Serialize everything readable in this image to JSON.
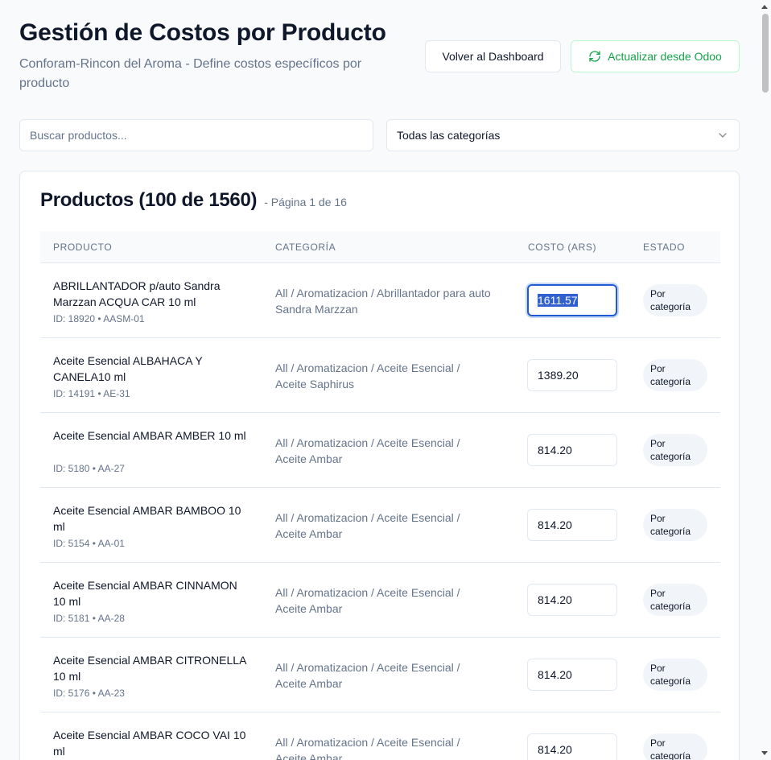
{
  "header": {
    "title": "Gestión de Costos por Producto",
    "subtitle": "Conforam-Rincon del Aroma - Define costos específicos por producto",
    "back_button": "Volver al Dashboard",
    "refresh_button": "Actualizar desde Odoo"
  },
  "filters": {
    "search_placeholder": "Buscar productos...",
    "category_selected": "Todas las categorías"
  },
  "products_card": {
    "title": "Productos (100 de 1560)",
    "page_info": "- Página 1 de 16",
    "columns": [
      "PRODUCTO",
      "CATEGORÍA",
      "COSTO (ARS)",
      "ESTADO"
    ],
    "rows": [
      {
        "name": "ABRILLANTADOR p/auto Sandra Marzzan ACQUA CAR 10 ml",
        "meta": "ID: 18920 • AASM-01",
        "category": "All / Aromatizacion / Abrillantador para auto Sandra Marzzan",
        "cost": "1611.57",
        "status": "Por categoría"
      },
      {
        "name": "Aceite Esencial ALBAHACA Y CANELA10 ml",
        "meta": "ID: 14191 • AE-31",
        "category": "All / Aromatizacion / Aceite Esencial / Aceite Saphirus",
        "cost": "1389.20",
        "status": "Por categoría"
      },
      {
        "name": "Aceite Esencial AMBAR AMBER 10 ml",
        "meta": "ID: 5180 • AA-27",
        "category": "All / Aromatizacion / Aceite Esencial / Aceite Ambar",
        "cost": "814.20",
        "status": "Por categoría"
      },
      {
        "name": "Aceite Esencial AMBAR BAMBOO 10 ml",
        "meta": "ID: 5154 • AA-01",
        "category": "All / Aromatizacion / Aceite Esencial / Aceite Ambar",
        "cost": "814.20",
        "status": "Por categoría"
      },
      {
        "name": "Aceite Esencial AMBAR CINNAMON 10 ml",
        "meta": "ID: 5181 • AA-28",
        "category": "All / Aromatizacion / Aceite Esencial / Aceite Ambar",
        "cost": "814.20",
        "status": "Por categoría"
      },
      {
        "name": "Aceite Esencial AMBAR CITRONELLA 10 ml",
        "meta": "ID: 5176 • AA-23",
        "category": "All / Aromatizacion / Aceite Esencial / Aceite Ambar",
        "cost": "814.20",
        "status": "Por categoría"
      },
      {
        "name": "Aceite Esencial AMBAR COCO VAI 10 ml",
        "meta": "",
        "category": "All / Aromatizacion / Aceite Esencial / Aceite Ambar",
        "cost": "814.20",
        "status": "Por categoría"
      }
    ]
  },
  "colors": {
    "accent_green": "#16a34a",
    "focus_blue": "#1e5bd4",
    "muted_text": "#64748b",
    "border": "#e2e8f0"
  },
  "icons": {
    "refresh": "refresh-icon",
    "select_arrow": "chevron-down-icon"
  }
}
